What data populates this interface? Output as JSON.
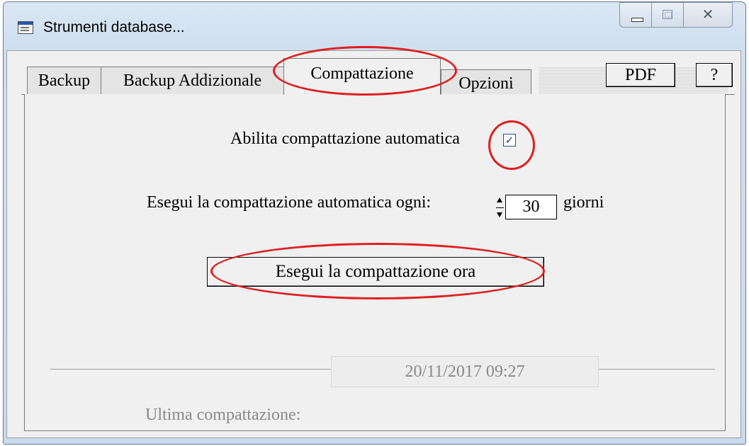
{
  "window": {
    "title": "Strumenti database...",
    "controls": {
      "minimize": "minimize-icon",
      "maximize": "maximize-icon",
      "close": "close-icon"
    }
  },
  "tabs": [
    {
      "label": "Backup",
      "active": false
    },
    {
      "label": "Backup Addizionale",
      "active": false
    },
    {
      "label": "Compattazione",
      "active": true
    },
    {
      "label": "Opzioni",
      "active": false
    }
  ],
  "toolbar": {
    "pdf_label": "PDF",
    "help_label": "?"
  },
  "compattazione": {
    "auto_label": "Abilita compattazione automatica",
    "auto_checked": true,
    "interval_label": "Esegui la compattazione automatica ogni:",
    "interval_value": "30",
    "interval_unit": "giorni",
    "run_button": "Esegui la compattazione ora",
    "last_label": "Ultima compattazione:",
    "last_value": "20/11/2017 09:27"
  },
  "colors": {
    "annotation": "#e01e1e",
    "checkbox_border": "#1c4e9a"
  }
}
